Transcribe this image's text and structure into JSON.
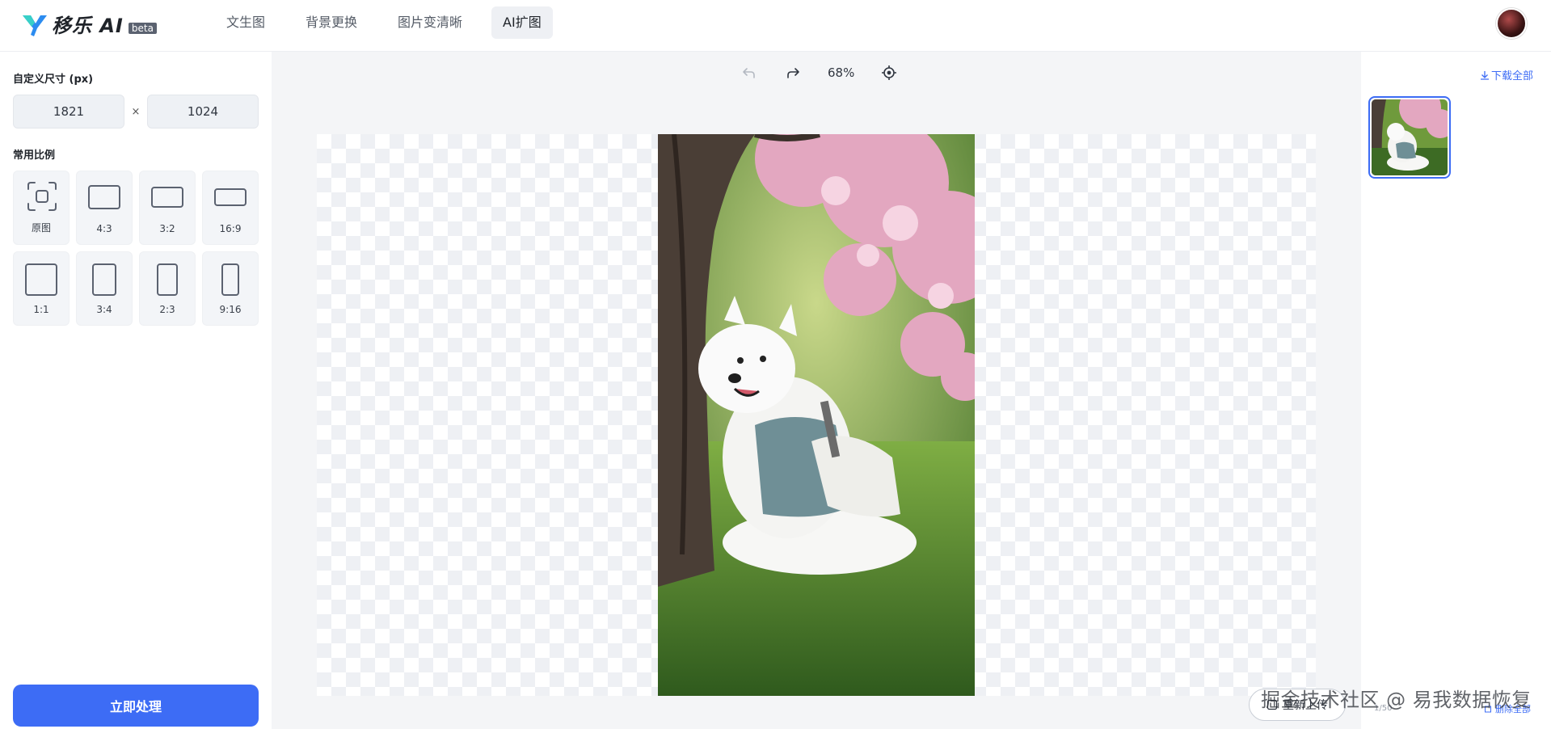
{
  "header": {
    "logo_text": "移乐 AI",
    "beta_label": "beta",
    "tabs": [
      {
        "label": "文生图",
        "active": false
      },
      {
        "label": "背景更换",
        "active": false
      },
      {
        "label": "图片变清晰",
        "active": false
      },
      {
        "label": "AI扩图",
        "active": true
      }
    ],
    "avatar_icon": "user-avatar"
  },
  "left_panel": {
    "custom_size_title": "自定义尺寸 (px)",
    "width_value": "1821",
    "height_value": "1024",
    "times_symbol": "×",
    "ratio_title": "常用比例",
    "ratios": [
      {
        "label": "原图",
        "icon": "original-frame-icon"
      },
      {
        "label": "4:3",
        "icon": "ratio-4-3-icon"
      },
      {
        "label": "3:2",
        "icon": "ratio-3-2-icon"
      },
      {
        "label": "16:9",
        "icon": "ratio-16-9-icon"
      },
      {
        "label": "1:1",
        "icon": "ratio-1-1-icon"
      },
      {
        "label": "3:4",
        "icon": "ratio-3-4-icon"
      },
      {
        "label": "2:3",
        "icon": "ratio-2-3-icon"
      },
      {
        "label": "9:16",
        "icon": "ratio-9-16-icon"
      }
    ],
    "process_button": "立即处理"
  },
  "toolbar": {
    "undo_icon": "undo-icon",
    "redo_icon": "redo-icon",
    "zoom": "68%",
    "locate_icon": "crosshair-icon"
  },
  "right_panel": {
    "download_all": "下载全部",
    "counter": "1/50",
    "delete_all": "删除全部"
  },
  "reupload_button": "重新上传",
  "watermark": "掘金技术社区 @ 易我数据恢复",
  "colors": {
    "accent": "#3d6cf5",
    "panel_bg": "#ffffff",
    "workspace_bg": "#f4f5f7"
  }
}
